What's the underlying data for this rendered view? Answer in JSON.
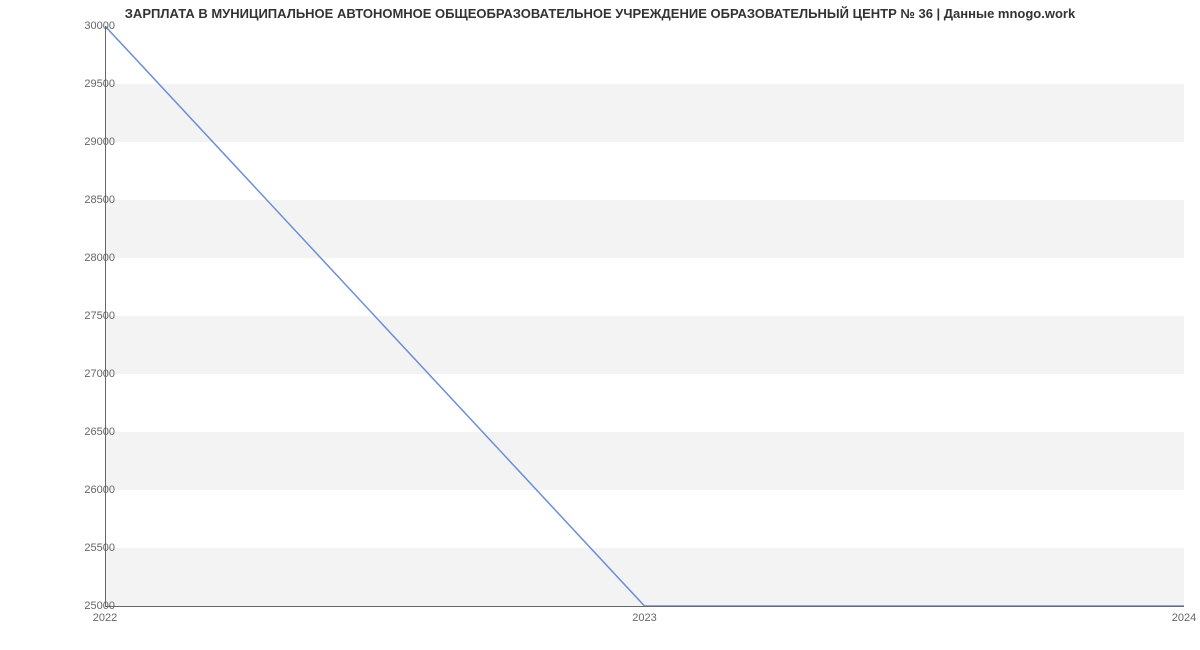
{
  "chart_data": {
    "type": "line",
    "title": "ЗАРПЛАТА В МУНИЦИПАЛЬНОЕ АВТОНОМНОЕ ОБЩЕОБРАЗОВАТЕЛЬНОЕ УЧРЕЖДЕНИЕ ОБРАЗОВАТЕЛЬНЫЙ ЦЕНТР № 36 | Данные mnogo.work",
    "x": [
      2022,
      2023,
      2024
    ],
    "values": [
      30000,
      25000,
      25000
    ],
    "xlabel": "",
    "ylabel": "",
    "xlim": [
      2022,
      2024
    ],
    "ylim": [
      25000,
      30000
    ],
    "yticks": [
      25000,
      25500,
      26000,
      26500,
      27000,
      27500,
      28000,
      28500,
      29000,
      29500,
      30000
    ],
    "xticks": [
      2022,
      2023,
      2024
    ],
    "grid": true
  }
}
